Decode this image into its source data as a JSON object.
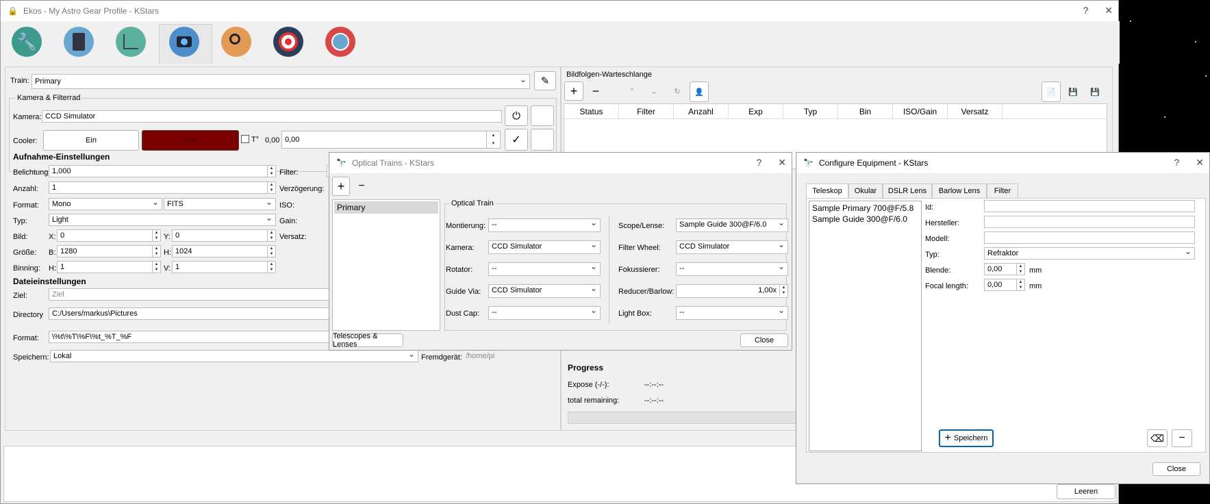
{
  "main": {
    "title": "Ekos - My Astro Gear Profile - KStars",
    "help": "?",
    "close": "✕",
    "train_label": "Train:",
    "train_value": "Primary",
    "camera_group": "Kamera & Filterrad",
    "kamera_label": "Kamera:",
    "kamera_value": "CCD Simulator",
    "cooler_label": "Cooler:",
    "cooler_on": "Ein",
    "cooler_off": "Aus",
    "temp_label": "T°",
    "temp_value": "0,00",
    "temp_set": "0,00",
    "aufnahme_title": "Aufnahme-Einstellungen",
    "belichtung_label": "Belichtung:",
    "belichtung_value": "1,000",
    "anzahl_label": "Anzahl:",
    "anzahl_value": "1",
    "format_label": "Format:",
    "format_value": "Mono",
    "format2_value": "FITS",
    "typ_label": "Typ:",
    "typ_value": "Light",
    "bild_label": "Bild:",
    "x_label": "X:",
    "x_value": "0",
    "y_label": "Y:",
    "y_value": "0",
    "groesse_label": "Größe:",
    "b_label": "B:",
    "b_value": "1280",
    "h_label": "H:",
    "h_value": "1024",
    "binning_label": "Binning:",
    "bh_label": "H:",
    "bh_value": "1",
    "bv_label": "V:",
    "bv_value": "1",
    "filter_label": "Filter:",
    "verzoegerung_label": "Verzögerung:",
    "iso_label": "ISO:",
    "gain_label": "Gain:",
    "versatz_label": "Versatz:",
    "datei_title": "Dateieinstellungen",
    "ziel_label": "Ziel:",
    "ziel_placeholder": "Ziel",
    "directory_label": "Directory",
    "directory_value": "C:/Users/markus\\Pictures",
    "dformat_label": "Format:",
    "dformat_value": "\\%t\\%T\\%F\\%t_%T_%F",
    "speichern_label": "Speichern:",
    "speichern_value": "Lokal",
    "fremd_label": "Fremdgerät:",
    "fremd_value": "/home/pi",
    "queue_title": "Bildfolgen-Warteschlange",
    "queue_columns": [
      "Status",
      "Filter",
      "Anzahl",
      "Exp",
      "Typ",
      "Bin",
      "ISO/Gain",
      "Versatz"
    ],
    "progress_title": "Progress",
    "expose_label": "Expose (-/-):",
    "expose_value": "--:--:--",
    "remaining_label": "total remaining:",
    "remaining_value": "--:--:--",
    "leeren": "Leeren"
  },
  "optical": {
    "title": "Optical Trains - KStars",
    "help": "?",
    "close": "✕",
    "add": "+",
    "remove": "−",
    "list": [
      "Primary"
    ],
    "group": "Optical Train",
    "montierung_label": "Montierung:",
    "montierung_value": "--",
    "kamera_label": "Kamera:",
    "kamera_value": "CCD Simulator",
    "rotator_label": "Rotator:",
    "rotator_value": "--",
    "guide_label": "Guide Via:",
    "guide_value": "CCD Simulator",
    "dust_label": "Dust Cap:",
    "dust_value": "--",
    "scope_label": "Scope/Lense:",
    "scope_value": "Sample Guide 300@F/6.0",
    "filterwheel_label": "Filter Wheel:",
    "filterwheel_value": "CCD Simulator",
    "fokus_label": "Fokussierer:",
    "fokus_value": "--",
    "reducer_label": "Reducer/Barlow:",
    "reducer_value": "1,00x",
    "lightbox_label": "Light Box:",
    "lightbox_value": "--",
    "telescopes_btn": "Telescopes & Lenses",
    "close_btn": "Close"
  },
  "equip": {
    "title": "Configure Equipment - KStars",
    "help": "?",
    "close": "✕",
    "tabs": [
      "Teleskop",
      "Okular",
      "DSLR Lens",
      "Barlow Lens",
      "Filter"
    ],
    "list": [
      "Sample Primary 700@F/5.8",
      "Sample Guide 300@F/6.0"
    ],
    "id_label": "Id:",
    "hersteller_label": "Hersteller:",
    "modell_label": "Modell:",
    "typ_label": "Typ:",
    "typ_value": "Refraktor",
    "blende_label": "Blende:",
    "blende_value": "0,00",
    "focal_label": "Focal length:",
    "focal_value": "0,00",
    "unit_mm": "mm",
    "save_btn": "Speichern",
    "close_btn": "Close"
  },
  "colors": {
    "cooler_off": "#7b0000",
    "accent": "#0063b1"
  }
}
